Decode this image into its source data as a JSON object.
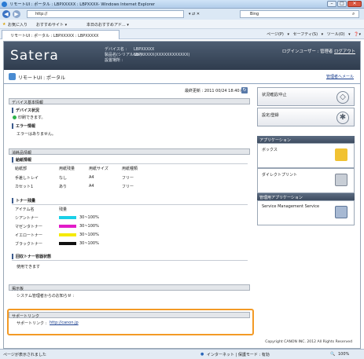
{
  "window": {
    "title": "リモートUI : ポータル : LBPXXXXX : LBPXXXX- Windows Internet Explorer",
    "buttons": [
      "–",
      "□",
      "✕"
    ]
  },
  "browser": {
    "url": "http://",
    "search_placeholder": "Bing",
    "favorites_label": "お気に入り",
    "fav_items": [
      "おすすめサイト ▾",
      "本日のおすすめアド... ▾"
    ],
    "tab_label": "リモートUI : ポータル : LBPXXXXX : LBPXXXXX",
    "commands": "ページ(P) ▾  セーフティ(S) ▾  ツール(O) ▾  ❓▾"
  },
  "header": {
    "logo": "Satera",
    "device_name_label": "デバイス名 :",
    "device_name_value": "LBPXXXXX",
    "product_label": "製品名(シリアルNo.) :",
    "product_value": "LBPXXXXX(XXXXXXXXXXXX)",
    "location_label": "設置場所 :",
    "location_value": "",
    "login_text": "ログインユーザー : 管理者",
    "logout_label": "ログアウト"
  },
  "subheader": {
    "title": "リモートUI : ポータル",
    "link": "管理者へメール"
  },
  "updated": "最終更新 : 2011 00/24 18:40:00",
  "device_info": {
    "heading": "デバイス基本情報",
    "status_title": "デバイス状況",
    "status_text": "印刷できます。",
    "error_title": "エラー情報",
    "error_text": "エラーはありません。"
  },
  "consumables": {
    "heading": "消耗品情報",
    "paper_title": "給紙情報",
    "paper_headers": [
      "給紙部",
      "用紙残量",
      "用紙サイズ",
      "用紙種類"
    ],
    "paper_rows": [
      [
        "手差しトレイ",
        "なし",
        "A4",
        "フリー"
      ],
      [
        "カセット1",
        "あり",
        "A4",
        "フリー"
      ]
    ],
    "toner_title": "トナー残量",
    "toner_headers": [
      "アイテム名",
      "残量"
    ],
    "toner_rows": [
      {
        "name": "シアントナー",
        "value": "30~100%",
        "color": "#1ad0e8"
      },
      {
        "name": "マゼンタトナー",
        "value": "30~100%",
        "color": "#e21cc8"
      },
      {
        "name": "イエロートナー",
        "value": "30~100%",
        "color": "#f5ea00"
      },
      {
        "name": "ブラックトナー",
        "value": "30~100%",
        "color": "#111111"
      }
    ],
    "waste_title": "回収トナー容器状態",
    "waste_text": "使用できます"
  },
  "notice": {
    "heading": "掲示板",
    "text": "システム管理者からのお知らせ :"
  },
  "support": {
    "heading": "サポートリンク",
    "label": "サポートリンク :",
    "link": "http://canon.jp"
  },
  "right": {
    "status_monitor": "状況確認/中止",
    "settings": "設定/登録",
    "apps_heading": "アプリケーション",
    "box": "ボックス",
    "direct_print": "ダイレクトプリント",
    "mgmt_heading": "管理用アプリケーション",
    "sms": "Service Management Service"
  },
  "copyright": "Copyright CANON INC. 2012 All Rights Reserved",
  "statusbar": {
    "left": "ページが表示されました",
    "zone": "インターネット | 保護モード : 有効",
    "zoom": "100%"
  }
}
